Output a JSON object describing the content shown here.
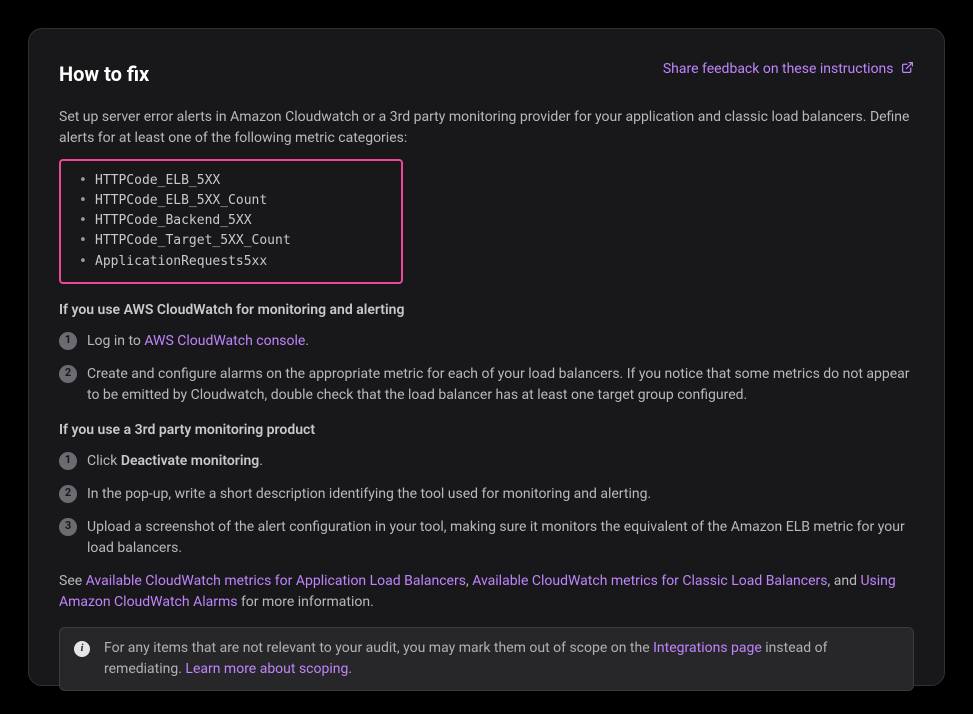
{
  "header": {
    "title": "How to fix",
    "feedback_link": "Share feedback on these instructions"
  },
  "intro": "Set up server error alerts in Amazon Cloudwatch or a 3rd party monitoring provider for your application and classic load balancers. Define alerts for at least one of the following metric categories:",
  "metrics": [
    "HTTPCode_ELB_5XX",
    "HTTPCode_ELB_5XX_Count",
    "HTTPCode_Backend_5XX",
    "HTTPCode_Target_5XX_Count",
    "ApplicationRequests5xx"
  ],
  "section_aws": {
    "label": "If you use AWS CloudWatch for monitoring and alerting",
    "steps": [
      {
        "prefix": "Log in to ",
        "link": "AWS CloudWatch console",
        "suffix": "."
      },
      {
        "text": "Create and configure alarms on the appropriate metric for each of your load balancers. If you notice that some metrics do not appear to be emitted by Cloudwatch, double check that the load balancer has at least one target group configured."
      }
    ]
  },
  "section_3p": {
    "label": "If you use a 3rd party monitoring product",
    "steps": [
      {
        "prefix": "Click ",
        "bold": "Deactivate monitoring",
        "suffix": "."
      },
      {
        "text": "In the pop-up, write a short description identifying the tool used for monitoring and alerting."
      },
      {
        "text": "Upload a screenshot of the alert configuration in your tool, making sure it monitors the equivalent of the Amazon ELB metric for your load balancers."
      }
    ]
  },
  "see_also": {
    "prefix": "See ",
    "link1": "Available CloudWatch metrics for Application Load Balancers",
    "mid1": ", ",
    "link2": "Available CloudWatch metrics for Classic Load Balancers",
    "mid2": ", and ",
    "link3": "Using Amazon CloudWatch Alarms",
    "suffix": " for more information."
  },
  "info": {
    "text1": "For any items that are not relevant to your audit, you may mark them out of scope on the ",
    "link1": "Integrations page",
    "text2": " instead of remediating. ",
    "link2": "Learn more about scoping",
    "text3": "."
  }
}
